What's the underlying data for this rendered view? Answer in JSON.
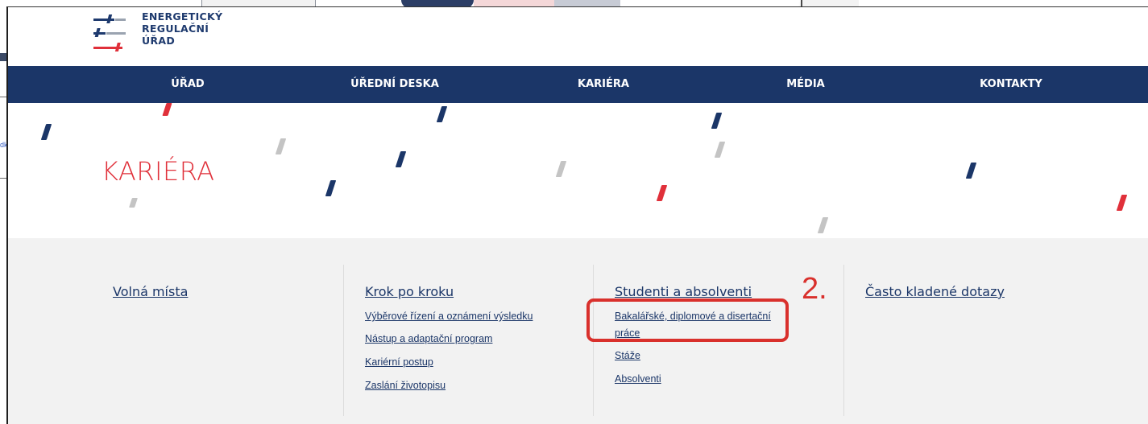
{
  "background": {
    "cut_link": "dk"
  },
  "logo": {
    "line1": "ENERGETICKÝ",
    "line2": "REGULAČNÍ",
    "line3": "ÚŘAD"
  },
  "nav": {
    "items": [
      "ÚŘAD",
      "ÚŘEDNÍ DESKA",
      "KARIÉRA",
      "MÉDIA",
      "KONTAKTY"
    ]
  },
  "hero": {
    "title": "KARIÉRA"
  },
  "columns": [
    {
      "heading": "Volná místa",
      "links": []
    },
    {
      "heading": "Krok po kroku",
      "links": [
        "Výběrové řízení a oznámení výsledku",
        "Nástup a adaptační program",
        "Kariérní postup",
        "Zaslání životopisu"
      ]
    },
    {
      "heading": "Studenti a absolventi",
      "links": [
        "Bakalářské, diplomové a disertační",
        "práce",
        "Stáže",
        "Absolventi"
      ]
    },
    {
      "heading": "Často kladené dotazy",
      "links": []
    }
  ],
  "annotation": {
    "label": "2.",
    "color": "#d9302c"
  },
  "colors": {
    "navy": "#1b3668",
    "red": "#e0303a",
    "grey": "#c4c4c4"
  }
}
